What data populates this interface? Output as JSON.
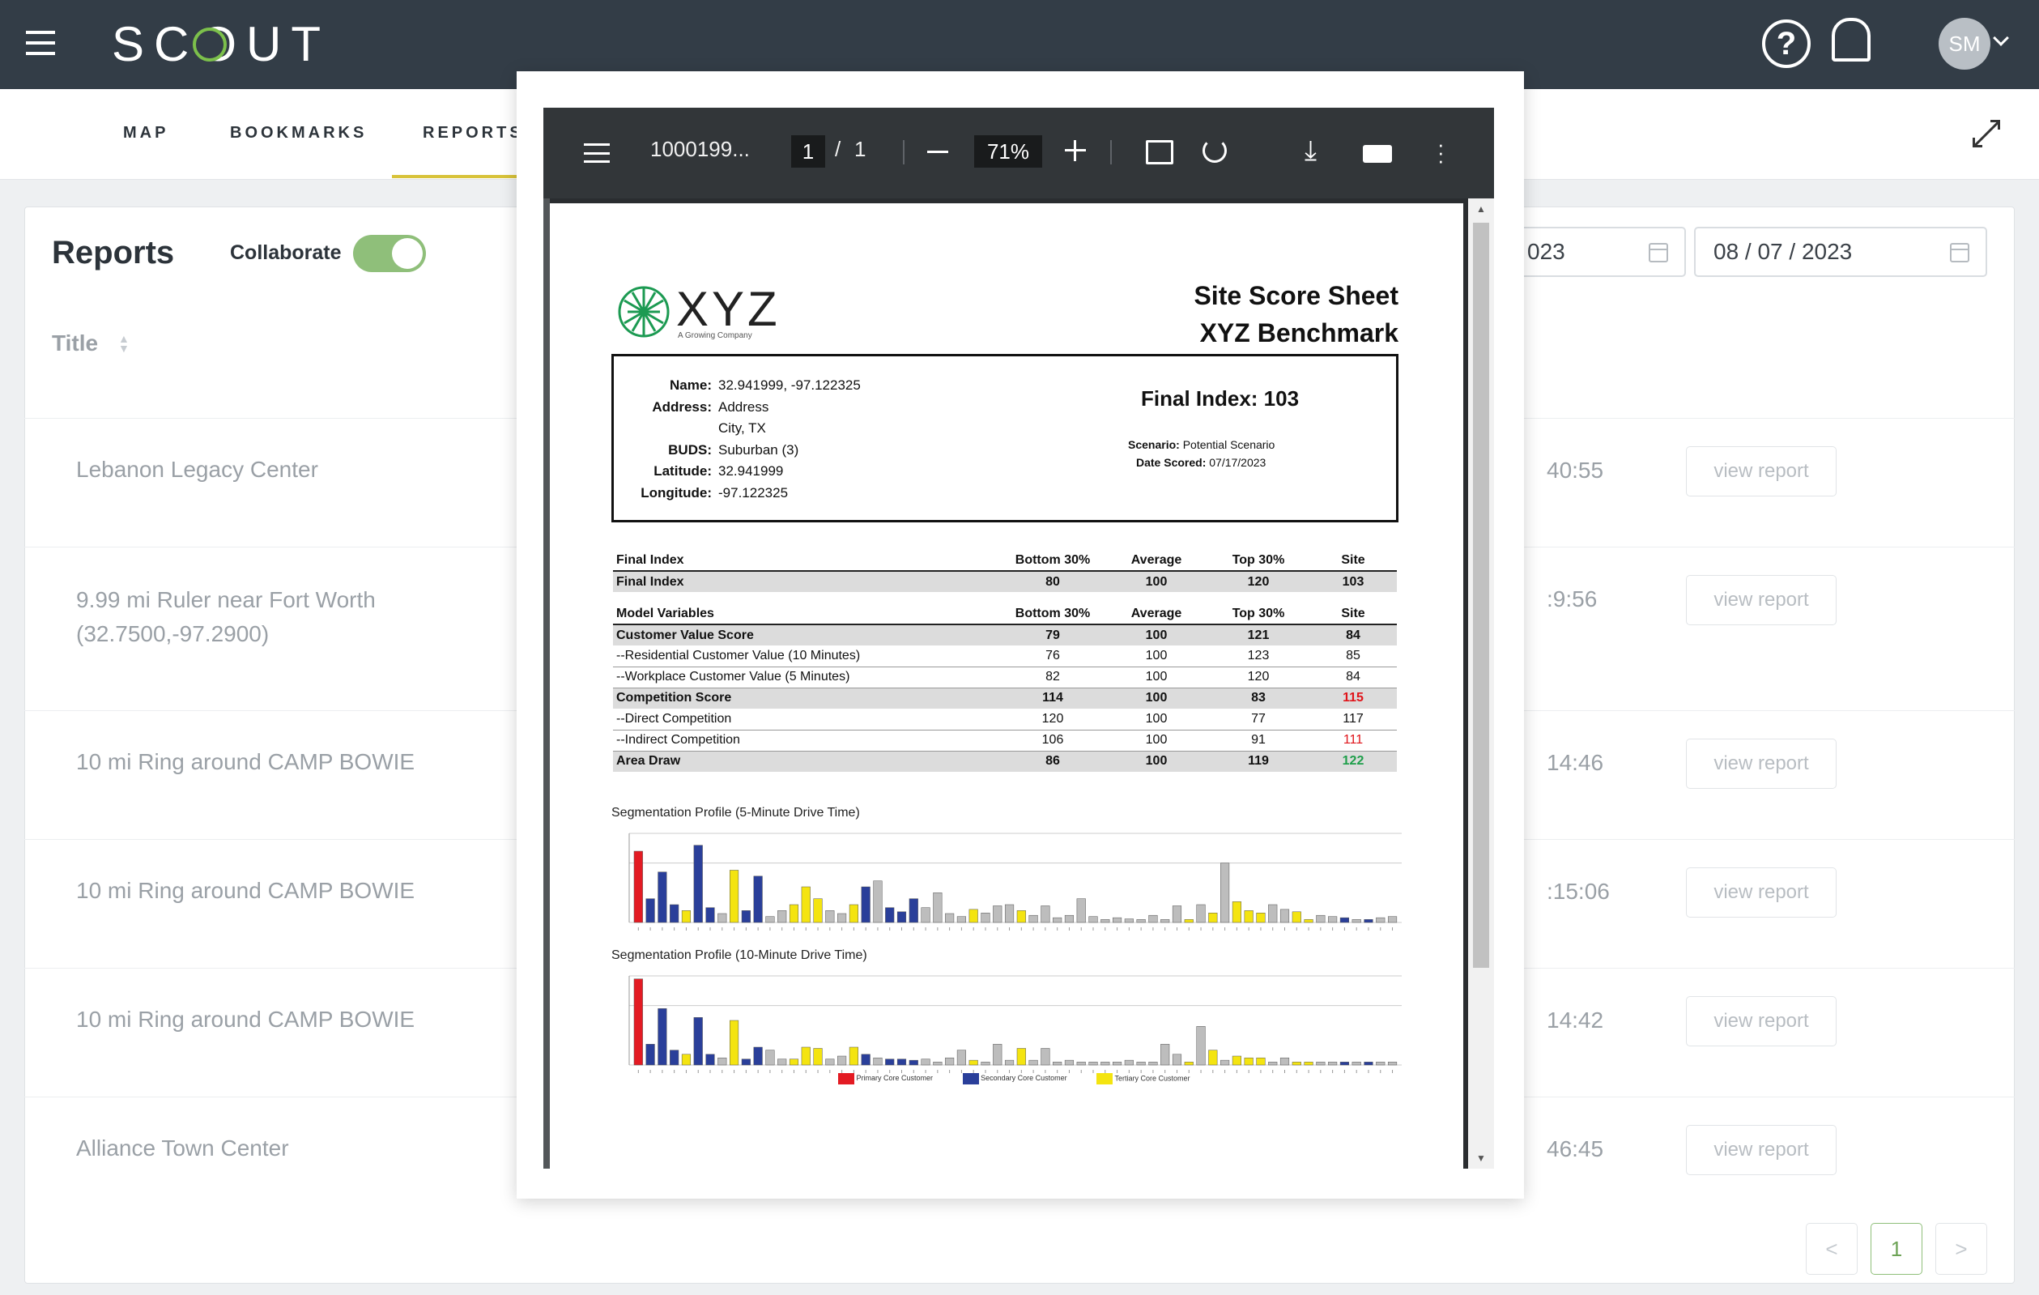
{
  "app": {
    "logo": "SCOUT",
    "user_initials": "SM",
    "brand_color": "#333d47",
    "accent": "#d8c33a"
  },
  "nav": {
    "items": [
      "MAP",
      "BOOKMARKS",
      "REPORTS"
    ]
  },
  "reports": {
    "title": "Reports",
    "collaborate_label": "Collaborate",
    "collaborate_on": true,
    "col_title": "Title",
    "date_from": "023",
    "date_to": "08 / 07 / 2023",
    "rows": [
      {
        "title": "Lebanon Legacy Center",
        "time": "40:55",
        "action": "view report"
      },
      {
        "title": "9.99 mi Ruler near Fort Worth (32.7500,-97.2900)",
        "time": ":9:56",
        "action": "view report"
      },
      {
        "title": "10 mi Ring around CAMP BOWIE",
        "time": "14:46",
        "action": "view report"
      },
      {
        "title": "10 mi Ring around CAMP BOWIE",
        "time": ":15:06",
        "action": "view report"
      },
      {
        "title": "10 mi Ring around CAMP BOWIE",
        "time": "14:42",
        "action": "view report"
      },
      {
        "title": "Alliance Town Center",
        "time": "46:45",
        "action": "view report"
      }
    ],
    "pagination": {
      "prev": "<",
      "current": "1",
      "next": ">"
    }
  },
  "viewer": {
    "filename": "1000199...",
    "page": "1",
    "sep": "/",
    "total": "1",
    "zoom": "71%"
  },
  "pdf": {
    "logo": "XYZ",
    "tagline": "A Growing Company",
    "title1": "Site Score Sheet",
    "title2": "XYZ Benchmark",
    "info": {
      "name_l": "Name:",
      "name": "32.941999, -97.122325",
      "addr_l": "Address:",
      "addr1": "Address",
      "addr2": "City, TX",
      "buds_l": "BUDS:",
      "buds": "Suburban (3)",
      "lat_l": "Latitude:",
      "lat": "32.941999",
      "lon_l": "Longitude:",
      "lon": "-97.122325"
    },
    "final_index": "Final Index: 103",
    "scenario_l": "Scenario:",
    "scenario": "Potential Scenario",
    "date_l": "Date Scored:",
    "date": "07/17/2023",
    "cols": [
      "Bottom 30%",
      "Average",
      "Top 30%",
      "Site"
    ],
    "t1": {
      "header": "Final Index",
      "rows": [
        {
          "label": "Final Index",
          "v": [
            "80",
            "100",
            "120",
            "103"
          ],
          "style": "s"
        }
      ]
    },
    "t2": {
      "header": "Model Variables",
      "rows": [
        {
          "label": "Customer Value Score",
          "v": [
            "79",
            "100",
            "121",
            "84"
          ],
          "style": "s"
        },
        {
          "label": "--Residential Customer Value (10 Minutes)",
          "v": [
            "76",
            "100",
            "123",
            "85"
          ],
          "style": "n"
        },
        {
          "label": "--Workplace Customer Value (5 Minutes)",
          "v": [
            "82",
            "100",
            "120",
            "84"
          ],
          "style": "n"
        },
        {
          "label": "Competition Score",
          "v": [
            "114",
            "100",
            "83",
            "115"
          ],
          "style": "s",
          "site_color": "red"
        },
        {
          "label": "--Direct Competition",
          "v": [
            "120",
            "100",
            "77",
            "117"
          ],
          "style": "n"
        },
        {
          "label": "--Indirect Competition",
          "v": [
            "106",
            "100",
            "91",
            "111"
          ],
          "style": "n",
          "site_color": "red"
        },
        {
          "label": "Area Draw",
          "v": [
            "86",
            "100",
            "119",
            "122"
          ],
          "style": "s",
          "site_color": "grn"
        }
      ]
    },
    "chart1_title": "Segmentation Profile (5-Minute Drive Time)",
    "chart2_title": "Segmentation Profile (10-Minute Drive Time)",
    "legend": [
      "Primary Core Customer",
      "Secondary Core Customer",
      "Tertiary Core Customer"
    ]
  },
  "chart_data": [
    {
      "type": "bar",
      "title": "Segmentation Profile (5-Minute Drive Time)",
      "ylim": [
        0,
        1.5
      ],
      "colors": {
        "r": "#e31b23",
        "b": "#2a3f9a",
        "y": "#f4e410",
        "g": "#bdbdbd"
      },
      "values": [
        1.2,
        0.4,
        0.85,
        0.3,
        0.2,
        1.3,
        0.25,
        0.15,
        0.88,
        0.2,
        0.78,
        0.1,
        0.2,
        0.3,
        0.6,
        0.4,
        0.2,
        0.15,
        0.3,
        0.6,
        0.7,
        0.25,
        0.18,
        0.4,
        0.25,
        0.5,
        0.15,
        0.1,
        0.22,
        0.16,
        0.28,
        0.3,
        0.2,
        0.12,
        0.28,
        0.08,
        0.12,
        0.4,
        0.1,
        0.05,
        0.08,
        0.06,
        0.05,
        0.12,
        0.05,
        0.28,
        0.05,
        0.3,
        0.16,
        1.0,
        0.35,
        0.2,
        0.16,
        0.3,
        0.22,
        0.18,
        0.05,
        0.12,
        0.1,
        0.08,
        0.05,
        0.05,
        0.08,
        0.1
      ],
      "kinds": "rbbbybbgybbggyyyggybgbbbggggygggygggggggggggggygygyyyggyyggbgbggggg"
    },
    {
      "type": "bar",
      "title": "Segmentation Profile (10-Minute Drive Time)",
      "ylim": [
        0,
        1.5
      ],
      "colors": {
        "r": "#e31b23",
        "b": "#2a3f9a",
        "y": "#f4e410",
        "g": "#bdbdbd"
      },
      "values": [
        1.45,
        0.35,
        0.95,
        0.25,
        0.18,
        0.8,
        0.18,
        0.12,
        0.75,
        0.1,
        0.3,
        0.25,
        0.1,
        0.1,
        0.3,
        0.28,
        0.1,
        0.15,
        0.3,
        0.18,
        0.12,
        0.1,
        0.1,
        0.08,
        0.1,
        0.05,
        0.12,
        0.25,
        0.08,
        0.05,
        0.35,
        0.08,
        0.28,
        0.08,
        0.28,
        0.05,
        0.08,
        0.05,
        0.05,
        0.05,
        0.05,
        0.08,
        0.05,
        0.05,
        0.35,
        0.18,
        0.05,
        0.65,
        0.25,
        0.08,
        0.15,
        0.12,
        0.12,
        0.05,
        0.12,
        0.05,
        0.05,
        0.05,
        0.05,
        0.05,
        0.05,
        0.05,
        0.05,
        0.05
      ],
      "kinds": "rbbbybbgybbggyyyggybgbbbggggygggygggggggggggggygygyyyggyyggbgbggggg"
    }
  ]
}
